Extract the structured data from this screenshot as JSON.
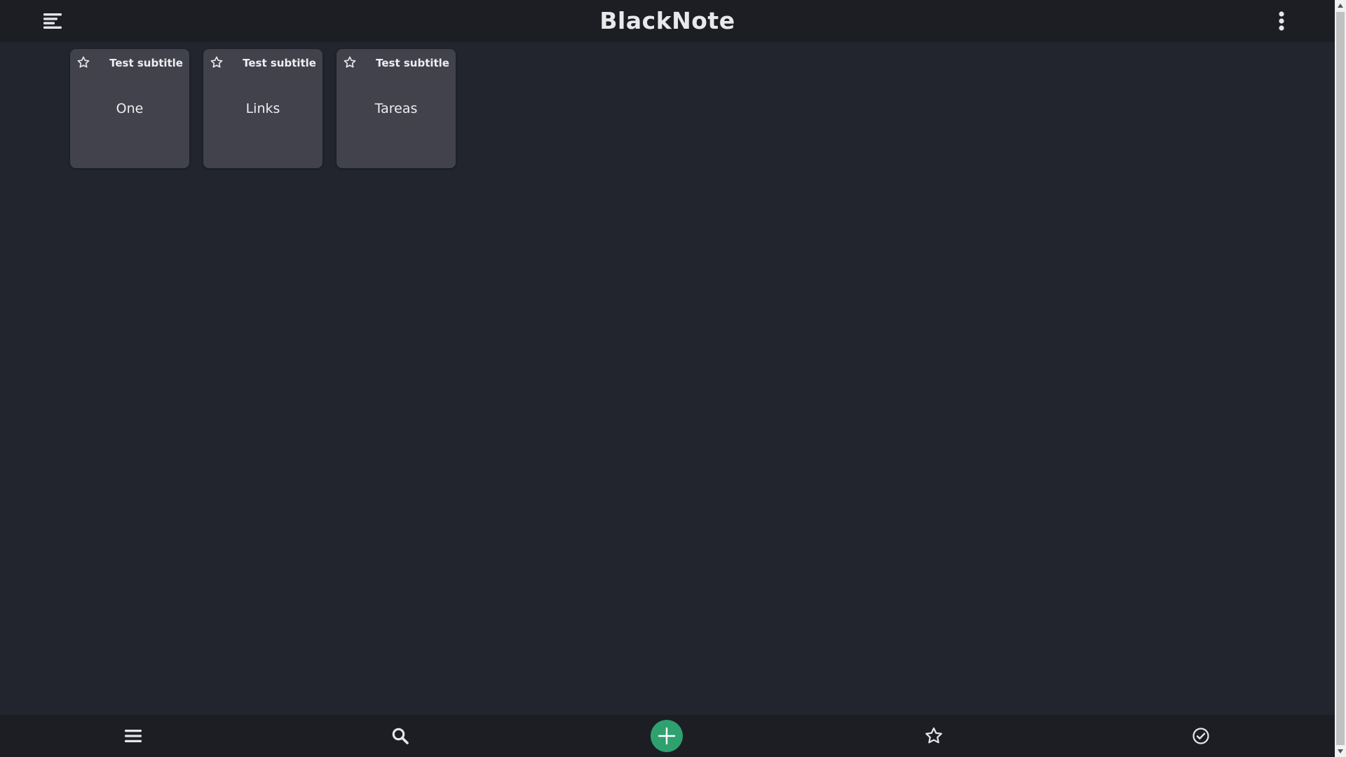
{
  "header": {
    "title": "BlackNote",
    "left_icon": "hamburger-menu-icon",
    "right_icon": "more-vertical-icon"
  },
  "notes": [
    {
      "subtitle": "Test subtitle",
      "title": "One",
      "favorite": false
    },
    {
      "subtitle": "Test subtitle",
      "title": "Links",
      "favorite": false
    },
    {
      "subtitle": "Test subtitle",
      "title": "Tareas",
      "favorite": false
    }
  ],
  "bottom_nav": {
    "items": [
      "menu-icon",
      "search-icon",
      "add-icon",
      "star-icon",
      "check-circle-icon"
    ]
  },
  "colors": {
    "background": "#22252e",
    "bar": "#1c1e23",
    "card": "#41424c",
    "accent": "#2ea16f",
    "text": "#eeeef2"
  }
}
